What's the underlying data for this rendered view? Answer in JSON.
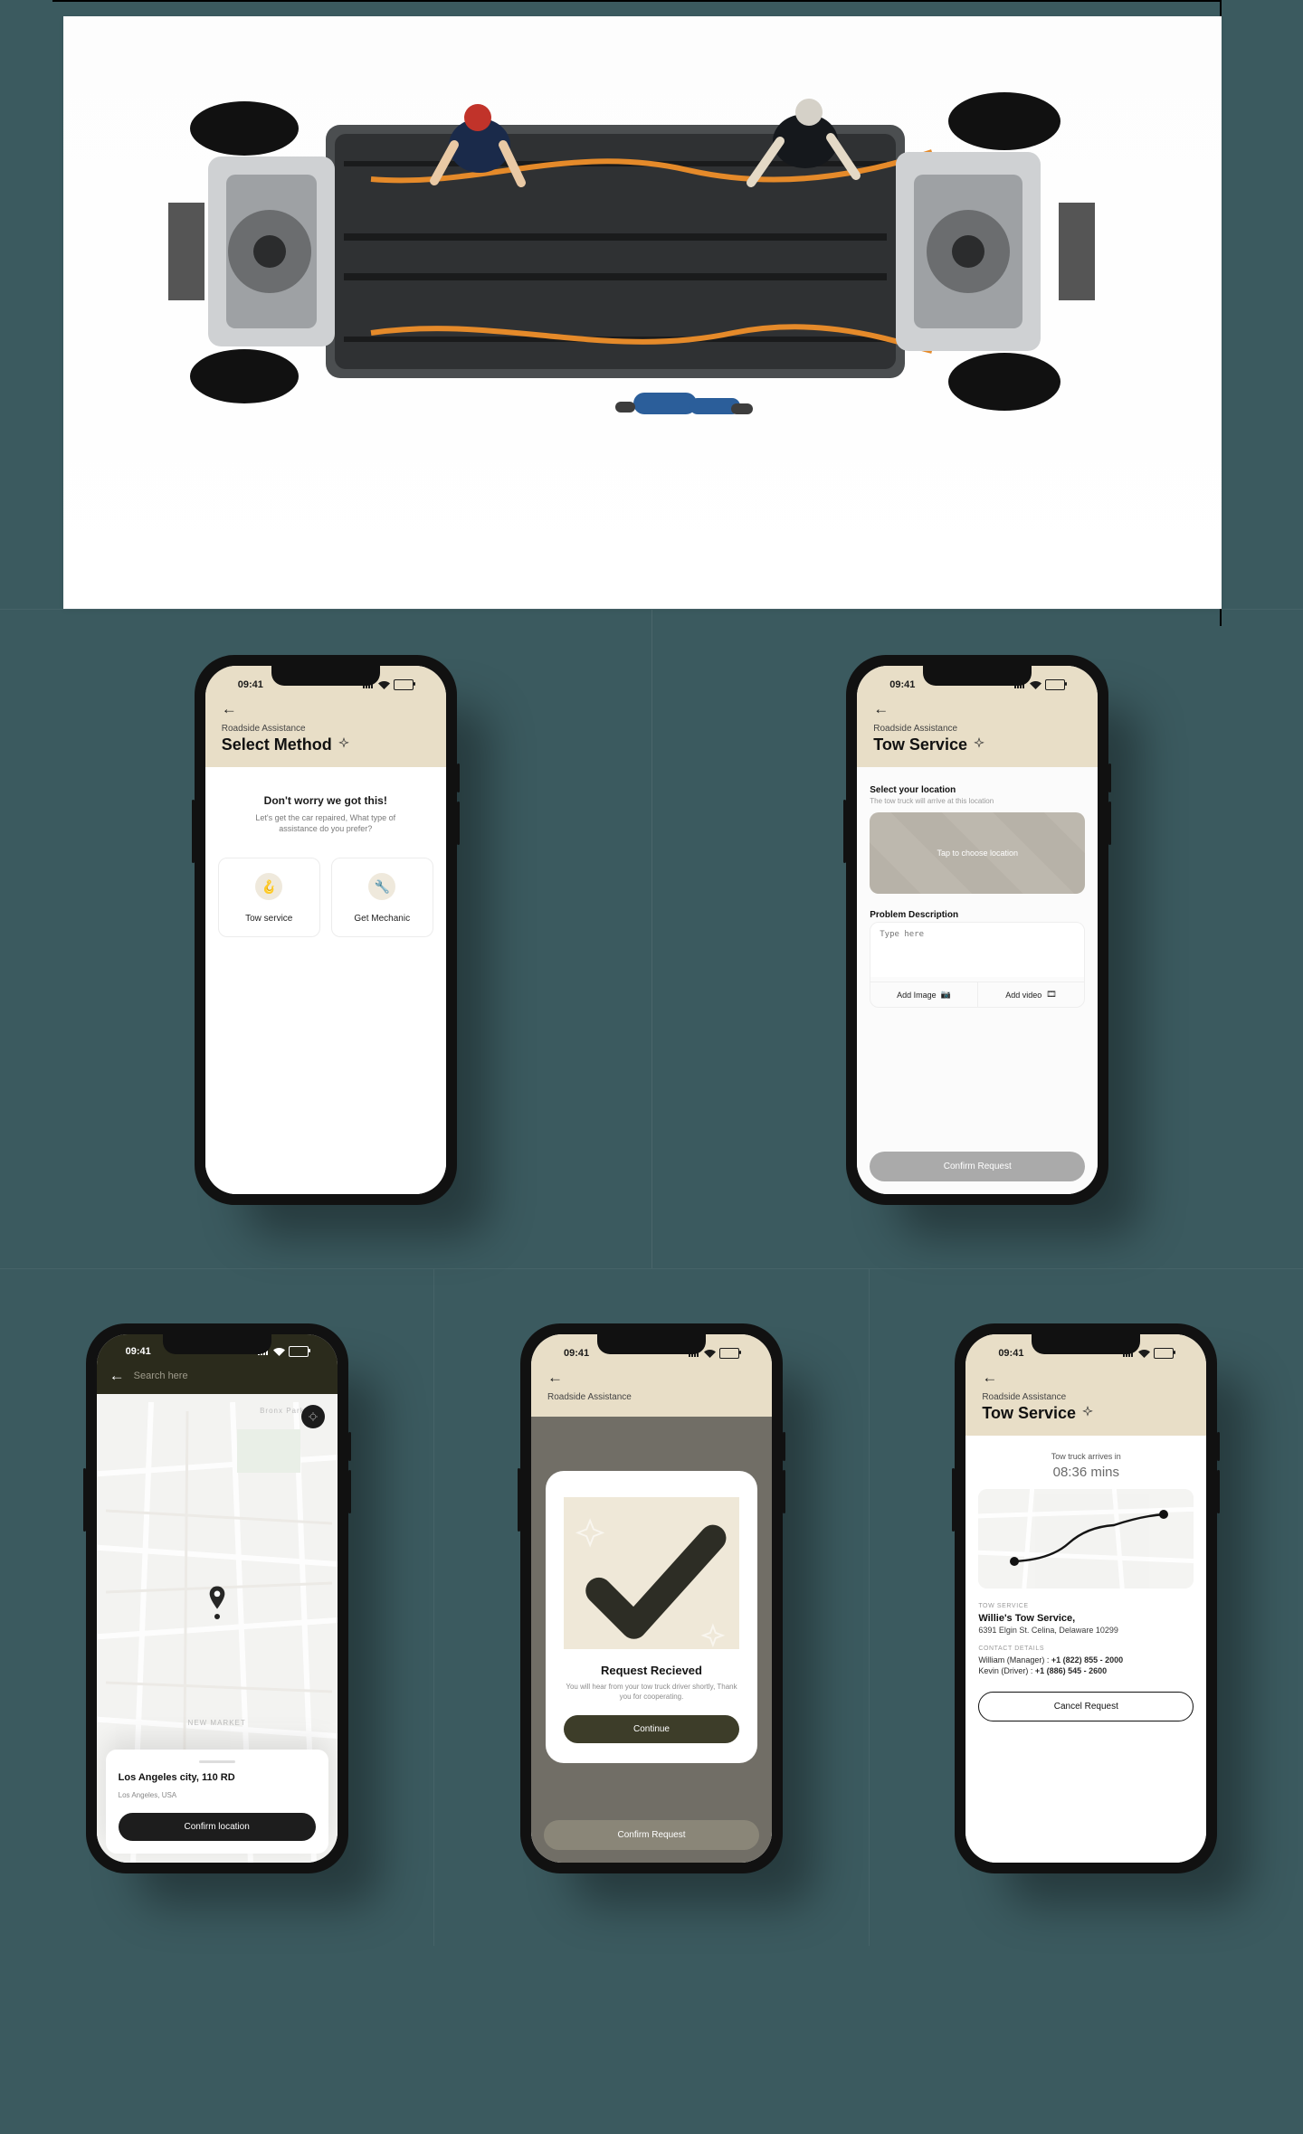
{
  "status_time": "09:41",
  "screens": {
    "s1": {
      "eyebrow": "Roadside Assistance",
      "title": "Select Method",
      "headline": "Don't worry we got this!",
      "subtext": "Let's get the car repaired, What type of assistance do you prefer?",
      "option_tow": "Tow service",
      "option_mech": "Get Mechanic"
    },
    "s2": {
      "eyebrow": "Roadside Assistance",
      "title": "Tow Service",
      "loc_label": "Select your location",
      "loc_hint": "The tow truck will arrive at this location",
      "tap_text": "Tap to choose location",
      "problem_label": "Problem Description",
      "placeholder": "Type here",
      "add_image": "Add Image",
      "add_video": "Add video",
      "cta": "Confirm Request"
    },
    "s3": {
      "search_placeholder": "Search here",
      "map_label_top": "Bronx Park",
      "map_label_bottom": "NEW MARKET",
      "city": "Los Angeles city, 110 RD",
      "region": "Los Angeles, USA",
      "cta": "Confirm location"
    },
    "s4": {
      "eyebrow": "Roadside Assistance",
      "title": "Request Recieved",
      "subtext": "You will hear from your tow truck driver shortly, Thank you for cooperating.",
      "cta_continue": "Continue",
      "cta_confirm": "Confirm Request"
    },
    "s5": {
      "eyebrow": "Roadside Assistance",
      "title": "Tow Service",
      "arrives_label": "Tow truck arrives in",
      "arrives_time": "08:36 mins",
      "tow_service_eye": "TOW SERVICE",
      "service_name": "Willie's Tow Service,",
      "service_addr": "6391 Elgin St. Celina, Delaware 10299",
      "contact_eye": "CONTACT DETAILS",
      "contact1_role": "William (Manager) : ",
      "contact1_num": "+1 (822) 855 - 2000",
      "contact2_role": "Kevin (Driver) : ",
      "contact2_num": "+1 (886) 545 - 2600",
      "cancel": "Cancel Request"
    }
  }
}
